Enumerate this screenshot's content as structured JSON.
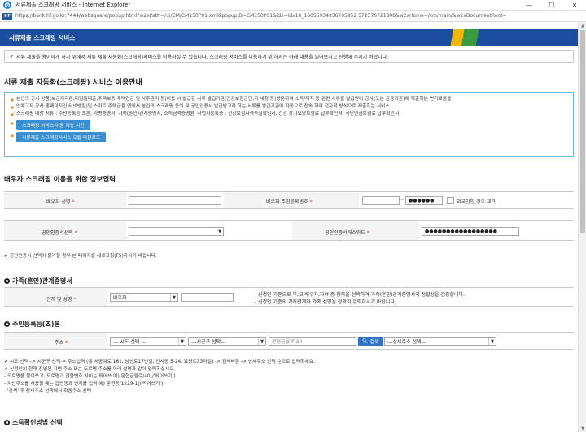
{
  "window": {
    "title": "서류제출 스크래핑 서비스 - Internet Explorer",
    "url": "https://bank.hf.go.kr:7444/websquare/popup.html?w2xPath=/ui/CM/CM150P01.xml&popupID=CM150P01&idx=idx10_16055934936705952 572376721808&w2xHome=/cm/main/&w2xDocumentRoot="
  },
  "banner": {
    "title": "서류제출 스크래핑 서비스"
  },
  "notice": "서류 제출을 용이하게 하기 위해서 서류 제출 자동화(스크래핑)서비스를 이용하실 수 있습니다. 스크래핑 서비스를 이용하기 위 해서는 아래 내용을 읽어보시고 진행해 주시기 바랍니다.",
  "guide": {
    "heading": "서류 제출 자동화(스크래핑) 서비스 이용안내",
    "lines": [
      "본인의 공사 상품(보금자리론,디딤돌대출,주택보증,주택연금 및 사후관리 등)이용 시 발급된 서류 발급기관(건강보험공단,국 세청 등)방문하여 소득/재직 등 관련 서류를 발급받아 공사(또는 금융기관)에 제출하는 번거로움을",
      "없애고자,공사 홈페이지인 터넷뱅킹)및 스마트 주택금융 앱에서 본인의 스크래핑 동의 및 공인인증서 발급받고자 하는 서류를 발급기관에 자동으로 접속 하여 전자적 방식으로 제출하는 서비스",
      "스크래핑 대상 서류 : 주민등록등·초본, 가병증명서, 가족(혼인)관계증명서, 소득금액증명원, 사업자등록증 , 건강보험자격득실확인서, 건강 장기요양보험료 납부확인서, 국민연금보험료 납부확인서"
    ],
    "buttons": [
      "스크래핑 서비스 이용 가능 시간",
      "서류제출 스크래핑서비스 모듈 다운로드"
    ]
  },
  "spouse_section": {
    "heading": "배우자 스크래핑 이용을 위한 정보입력",
    "name_label": "배우자 성명",
    "rrn_label": "배우자 주민등록번호",
    "rrn_back": "●●●●●●",
    "foreign_check_label": "외국인인 경우 체크",
    "cert_select_label": "공인인증서선택",
    "cert_pw_label": "공인인증서패스워드",
    "cert_pw_value": "●●●●●●●●●●●●●●●●●",
    "cert_note": "공인인증서 선택이 불가할 경우 본 페이지를 새로고침(F5)하시기 바랍니다."
  },
  "family_section": {
    "heading": "가족(혼인)관계증명서",
    "relation_label": "관계 및 성명",
    "relation_value": "배우자",
    "notes": [
      "- 신청인 기준으로 부,모,배우자,자녀 중 항목을 선택하여 가족(혼인)관계증명서의 정합성을 검증합니다.",
      "- 신청인 기준의 가족관계와 가족 성명을 정확히 입력하시기 바랍니다."
    ]
  },
  "address_section": {
    "heading": "주민등록등(초)본",
    "address_label": "주소",
    "sido_select": "--- 시도 선택 ---",
    "sigungu_select": "---시군구 선택---",
    "road_placeholder": "문현금융로 40",
    "search_button": "검색",
    "detail_select": "---상세주소 선택---",
    "notes": [
      "시도 선택 -> 시군구 선택-> 주소입력 (예 세종여로 161, 남산로17번길, 인사동 5-24, 효령로33마길) -> 검색버튼 -> 상세주소 선택 순으로 입력하세요.",
      "신청인의 현재 전입된 지번 주소 또는 도로명 주소를 아래 설명과 같이 입력하십시오.",
      "- 도로명을 붙여쓰고, 도로명과 건물번호 사이는 띄어쓰 예) 문현금융로/40(/'띄어쓰기')",
      "- 지번주소를 사용할 때는 읍면동과 번지를 입력 예) 문현동/1229-1(/'띄어쓰기')",
      "- '검색' 후 상세주소 선택에서 최종주소 선택"
    ]
  },
  "income_section": {
    "heading": "소득확인방법 선택"
  }
}
